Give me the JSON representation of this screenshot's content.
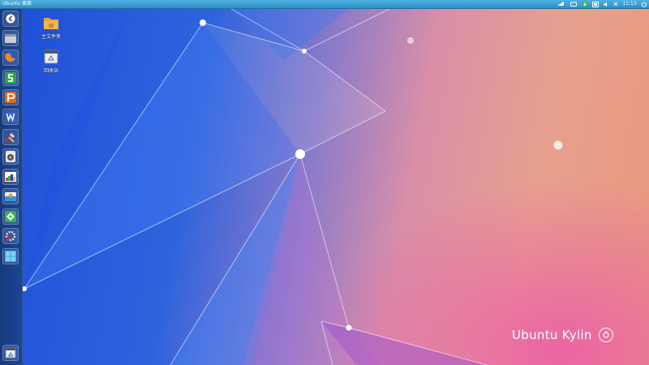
{
  "top_panel": {
    "title": "Ubuntu 桌面",
    "clock": "11:13",
    "tray_icons": [
      "network-icon",
      "keyboard-icon",
      "update-icon",
      "battery-icon",
      "sound-icon",
      "language-icon",
      "clock",
      "power-icon"
    ]
  },
  "launcher": {
    "items": [
      {
        "name": "dash-home",
        "icon": "ubuntu-dash-icon"
      },
      {
        "name": "files",
        "icon": "file-manager-icon"
      },
      {
        "name": "firefox",
        "icon": "firefox-icon"
      },
      {
        "name": "wps-spreadsheets",
        "icon": "wps-spreadsheets-icon"
      },
      {
        "name": "wps-presentation",
        "icon": "wps-presentation-icon"
      },
      {
        "name": "wps-writer",
        "icon": "wps-writer-icon"
      },
      {
        "name": "tools",
        "icon": "tools-icon"
      },
      {
        "name": "media-player",
        "icon": "media-player-icon"
      },
      {
        "name": "image-viewer",
        "icon": "image-viewer-icon"
      },
      {
        "name": "software-center",
        "icon": "software-center-icon"
      },
      {
        "name": "kylin-assistant",
        "icon": "kylin-assistant-icon"
      },
      {
        "name": "system-settings",
        "icon": "system-settings-icon"
      },
      {
        "name": "workspace-switcher",
        "icon": "workspace-switcher-icon"
      }
    ],
    "trash_icon": "trash-icon"
  },
  "desktop_icons": [
    {
      "label": "主文件夹",
      "icon": "home-folder-icon"
    },
    {
      "label": "回收站",
      "icon": "trash-icon"
    }
  ],
  "brand": {
    "text": "Ubuntu Kylin"
  },
  "colors": {
    "panel": "#2d8fc9",
    "launcher": "#1c4594",
    "desktop_blue": "#1e4fd8",
    "desktop_pink": "#e05ba8",
    "desktop_peach": "#e8987d"
  }
}
